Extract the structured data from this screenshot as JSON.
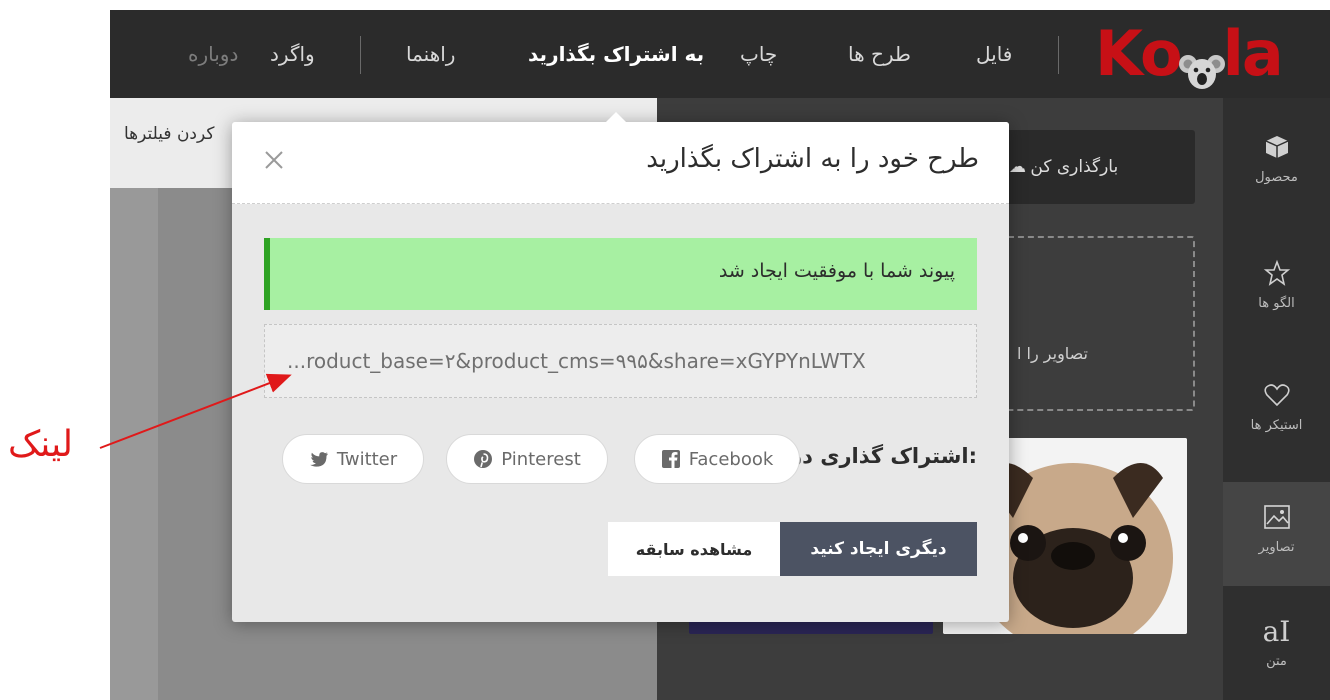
{
  "topbar": {
    "logo_left": "Ko",
    "logo_right": "la",
    "menu": {
      "file": "فایل",
      "designs": "طرح ها",
      "print": "چاپ",
      "share": "به اشتراک بگذارید",
      "help": "راهنما",
      "undo": "واگرد",
      "redo": "دوباره"
    }
  },
  "work": {
    "filter_text": "کردن فیلترها"
  },
  "panel": {
    "upload_label": "بارگذاری کن",
    "dropzone_text": "تصاویر را ا"
  },
  "sidebar": {
    "items": [
      {
        "label": "محصول",
        "icon": "cube-icon"
      },
      {
        "label": "الگو ها",
        "icon": "star-icon"
      },
      {
        "label": "استیکر ها",
        "icon": "heart-icon"
      },
      {
        "label": "تصاویر",
        "icon": "image-icon"
      },
      {
        "label": "متن",
        "icon": "text-icon"
      }
    ]
  },
  "modal": {
    "title": "طرح خود را به اشتراک بگذارید",
    "close_icon": "close-icon",
    "success_message": "پیوند شما با موفقیت ایجاد شد",
    "link_value": "...roduct_base=۲&product_cms=۹۹۵&share=xGYPYnLWTX",
    "share_label": "اشتراک گذاری در:",
    "share_buttons": {
      "facebook": "Facebook",
      "pinterest": "Pinterest",
      "twitter": "Twitter"
    },
    "create_another": "دیگری ایجاد کنید",
    "view_history": "مشاهده سابقه"
  },
  "annotation": {
    "label": "لینک",
    "color": "#e0191a"
  },
  "colors": {
    "topbar": "#2b2b2b",
    "logo": "#c71016",
    "success_bg": "#a7f0a2",
    "success_border": "#2ea323",
    "primary_button": "#4c5363"
  }
}
